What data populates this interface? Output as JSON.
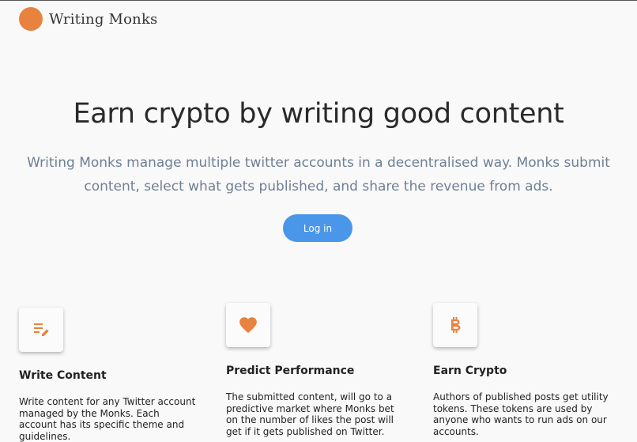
{
  "header": {
    "brand": "Writing Monks",
    "logo_color": "#e8823f"
  },
  "hero": {
    "title": "Earn crypto by writing good content",
    "subtitle": "Writing Monks manage multiple twitter accounts in a decentralised way. Monks submit content, select what gets published, and share the revenue from ads.",
    "login_label": "Log in",
    "accent": "#4a97ea"
  },
  "features": [
    {
      "icon": "notes-edit-icon",
      "title": "Write Content",
      "description": "Write content for any Twitter account managed by the Monks. Each account has its specific theme and guidelines."
    },
    {
      "icon": "heart-icon",
      "title": "Predict Performance",
      "description": "The submitted content, will go to a predictive market where Monks bet on the number of likes the post will get if it gets published on Twitter."
    },
    {
      "icon": "bitcoin-icon",
      "title": "Earn Crypto",
      "description": "Authors of published posts get utility tokens. These tokens are used by anyone who wants to run ads on our accounts."
    }
  ],
  "icon_color": "#e8823f"
}
